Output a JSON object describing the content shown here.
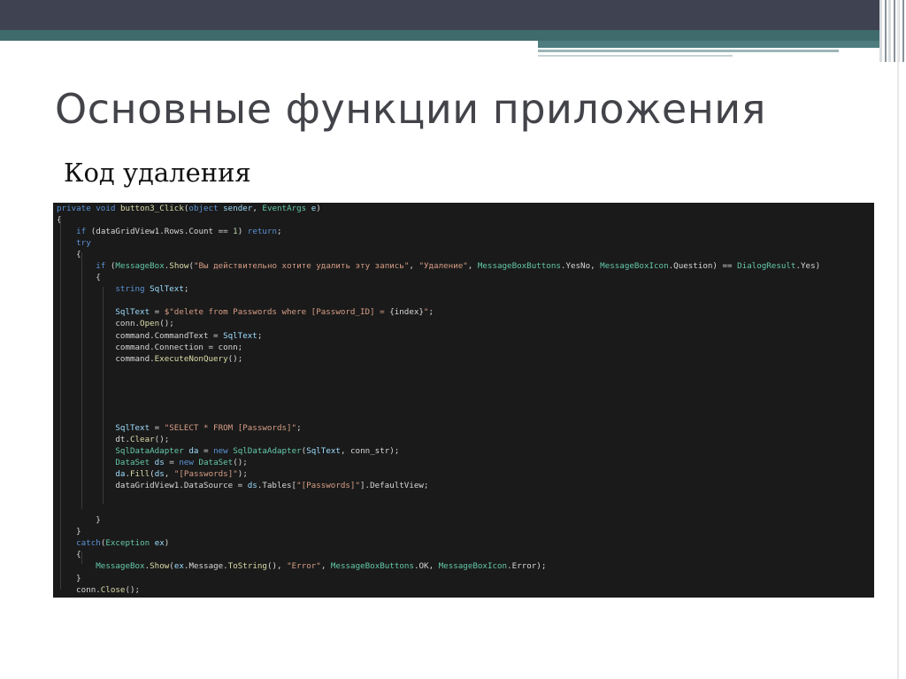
{
  "slide": {
    "title": "Основные функции приложения",
    "subtitle": "Код удаления"
  },
  "code": {
    "language": "C#",
    "lines": [
      [
        [
          "kw",
          "private "
        ],
        [
          "kw",
          "void "
        ],
        [
          "me",
          "button3_Click"
        ],
        [
          "pl",
          "("
        ],
        [
          "kw",
          "object "
        ],
        [
          "id",
          "sender"
        ],
        [
          "pl",
          ", "
        ],
        [
          "ty",
          "EventArgs "
        ],
        [
          "id",
          "e"
        ],
        [
          "pl",
          ")"
        ]
      ],
      [
        [
          "pl",
          "{"
        ]
      ],
      [
        [
          "pl",
          "    "
        ],
        [
          "kw",
          "if "
        ],
        [
          "pl",
          "(dataGridView1.Rows.Count == "
        ],
        [
          "nu",
          "1"
        ],
        [
          "pl",
          ") "
        ],
        [
          "kw",
          "return"
        ],
        [
          "pl",
          ";"
        ]
      ],
      [
        [
          "pl",
          "    "
        ],
        [
          "kw",
          "try"
        ]
      ],
      [
        [
          "pl",
          "    {"
        ]
      ],
      [
        [
          "pl",
          "        "
        ],
        [
          "kw",
          "if "
        ],
        [
          "pl",
          "("
        ],
        [
          "ty",
          "MessageBox"
        ],
        [
          "pl",
          "."
        ],
        [
          "me",
          "Show"
        ],
        [
          "pl",
          "("
        ],
        [
          "st",
          "\"Вы действительно хотите удалить эту запись\""
        ],
        [
          "pl",
          ", "
        ],
        [
          "st",
          "\"Удаление\""
        ],
        [
          "pl",
          ", "
        ],
        [
          "ty",
          "MessageBoxButtons"
        ],
        [
          "pl",
          ".YesNo, "
        ],
        [
          "ty",
          "MessageBoxIcon"
        ],
        [
          "pl",
          ".Question) == "
        ],
        [
          "ty",
          "DialogResult"
        ],
        [
          "pl",
          ".Yes)"
        ]
      ],
      [
        [
          "pl",
          "        {"
        ]
      ],
      [
        [
          "pl",
          "            "
        ],
        [
          "kw",
          "string "
        ],
        [
          "id",
          "SqlText"
        ],
        [
          "pl",
          ";"
        ]
      ],
      [
        [
          "pl",
          ""
        ]
      ],
      [
        [
          "pl",
          "            "
        ],
        [
          "id",
          "SqlText"
        ],
        [
          "pl",
          " = "
        ],
        [
          "st",
          "$\"delete from Passwords where [Password_ID] = "
        ],
        [
          "pl",
          "{index}"
        ],
        [
          "st",
          "\""
        ],
        [
          "pl",
          ";"
        ]
      ],
      [
        [
          "pl",
          "            conn."
        ],
        [
          "me",
          "Open"
        ],
        [
          "pl",
          "();"
        ]
      ],
      [
        [
          "pl",
          "            command.CommandText = "
        ],
        [
          "id",
          "SqlText"
        ],
        [
          "pl",
          ";"
        ]
      ],
      [
        [
          "pl",
          "            command.Connection = conn;"
        ]
      ],
      [
        [
          "pl",
          "            command."
        ],
        [
          "me",
          "ExecuteNonQuery"
        ],
        [
          "pl",
          "();"
        ]
      ],
      [
        [
          "pl",
          ""
        ]
      ],
      [
        [
          "pl",
          ""
        ]
      ],
      [
        [
          "pl",
          ""
        ]
      ],
      [
        [
          "pl",
          ""
        ]
      ],
      [
        [
          "pl",
          ""
        ]
      ],
      [
        [
          "pl",
          "            "
        ],
        [
          "id",
          "SqlText"
        ],
        [
          "pl",
          " = "
        ],
        [
          "st",
          "\"SELECT * FROM [Passwords]\""
        ],
        [
          "pl",
          ";"
        ]
      ],
      [
        [
          "pl",
          "            dt."
        ],
        [
          "me",
          "Clear"
        ],
        [
          "pl",
          "();"
        ]
      ],
      [
        [
          "pl",
          "            "
        ],
        [
          "ty",
          "SqlDataAdapter "
        ],
        [
          "id",
          "da"
        ],
        [
          "pl",
          " = "
        ],
        [
          "kw",
          "new "
        ],
        [
          "ty",
          "SqlDataAdapter"
        ],
        [
          "pl",
          "("
        ],
        [
          "id",
          "SqlText"
        ],
        [
          "pl",
          ", conn_str);"
        ]
      ],
      [
        [
          "pl",
          "            "
        ],
        [
          "ty",
          "DataSet "
        ],
        [
          "id",
          "ds"
        ],
        [
          "pl",
          " = "
        ],
        [
          "kw",
          "new "
        ],
        [
          "ty",
          "DataSet"
        ],
        [
          "pl",
          "();"
        ]
      ],
      [
        [
          "pl",
          "            "
        ],
        [
          "id",
          "da"
        ],
        [
          "pl",
          "."
        ],
        [
          "me",
          "Fill"
        ],
        [
          "pl",
          "("
        ],
        [
          "id",
          "ds"
        ],
        [
          "pl",
          ", "
        ],
        [
          "st",
          "\"[Passwords]\""
        ],
        [
          "pl",
          ");"
        ]
      ],
      [
        [
          "pl",
          "            dataGridView1.DataSource = "
        ],
        [
          "id",
          "ds"
        ],
        [
          "pl",
          ".Tables["
        ],
        [
          "st",
          "\"[Passwords]\""
        ],
        [
          "pl",
          "].DefaultView;"
        ]
      ],
      [
        [
          "pl",
          ""
        ]
      ],
      [
        [
          "pl",
          ""
        ]
      ],
      [
        [
          "pl",
          "        }"
        ]
      ],
      [
        [
          "pl",
          "    }"
        ]
      ],
      [
        [
          "pl",
          "    "
        ],
        [
          "kw",
          "catch"
        ],
        [
          "pl",
          "("
        ],
        [
          "ty",
          "Exception "
        ],
        [
          "id",
          "ex"
        ],
        [
          "pl",
          ")"
        ]
      ],
      [
        [
          "pl",
          "    {"
        ]
      ],
      [
        [
          "pl",
          "        "
        ],
        [
          "ty",
          "MessageBox"
        ],
        [
          "pl",
          "."
        ],
        [
          "me",
          "Show"
        ],
        [
          "pl",
          "("
        ],
        [
          "id",
          "ex"
        ],
        [
          "pl",
          ".Message."
        ],
        [
          "me",
          "ToString"
        ],
        [
          "pl",
          "(), "
        ],
        [
          "st",
          "\"Error\""
        ],
        [
          "pl",
          ", "
        ],
        [
          "ty",
          "MessageBoxButtons"
        ],
        [
          "pl",
          ".OK, "
        ],
        [
          "ty",
          "MessageBoxIcon"
        ],
        [
          "pl",
          ".Error);"
        ]
      ],
      [
        [
          "pl",
          "    }"
        ]
      ],
      [
        [
          "pl",
          "    conn."
        ],
        [
          "me",
          "Close"
        ],
        [
          "pl",
          "();"
        ]
      ],
      [
        [
          "pl",
          "}"
        ]
      ]
    ]
  }
}
